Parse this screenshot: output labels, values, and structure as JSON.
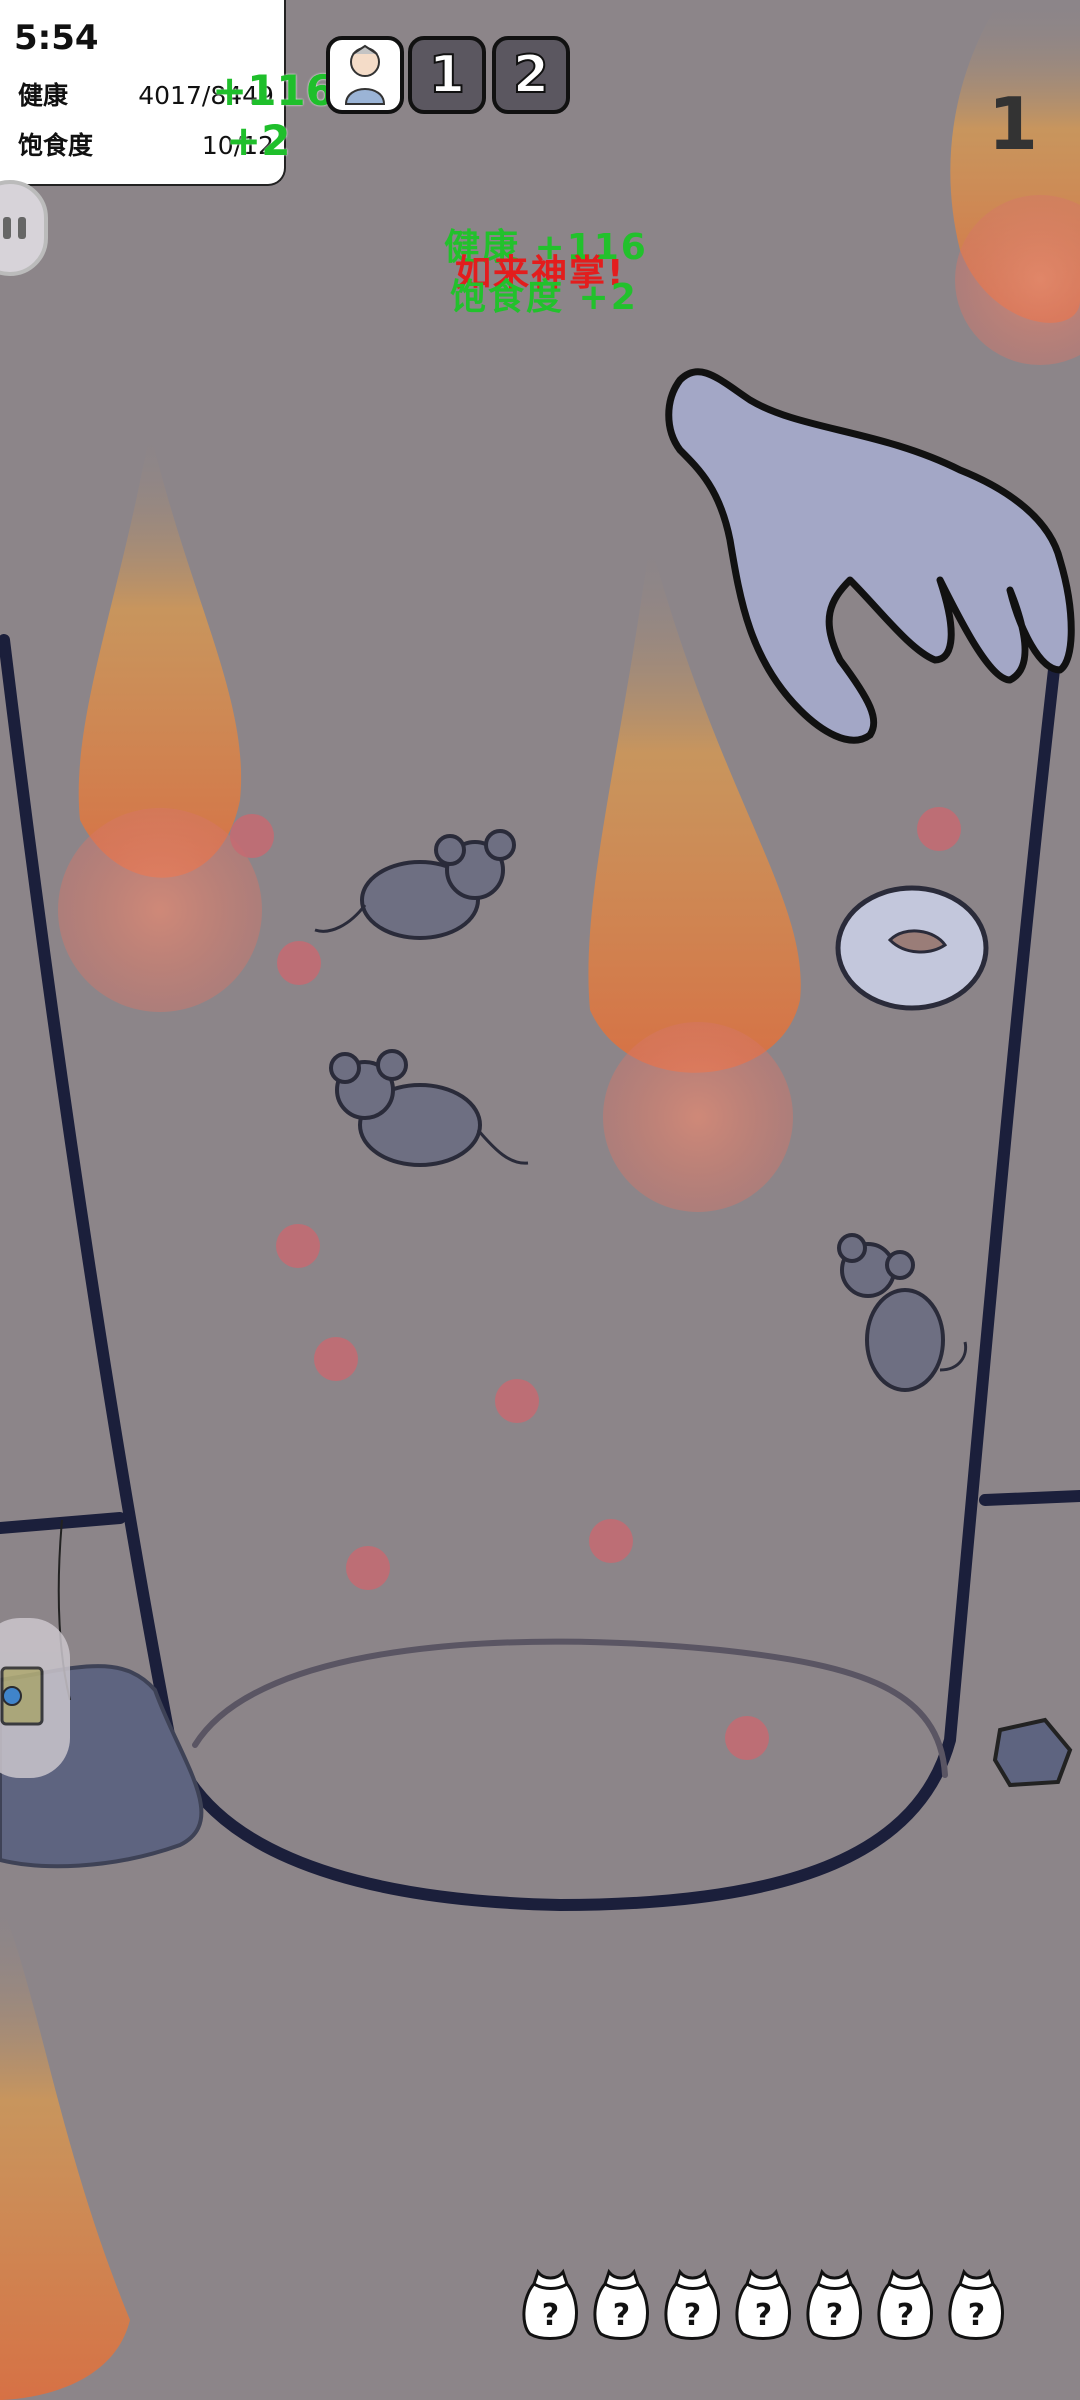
{
  "hud": {
    "time": "5:54",
    "health_label": "健康",
    "health_value": "4017/8449",
    "satiety_label": "饱食度",
    "satiety_value": "10/12",
    "health_gain": "+116",
    "satiety_gain": "+2"
  },
  "tags": {
    "slot_1": "1",
    "slot_2": "2"
  },
  "round_number": "1",
  "popup": {
    "health": "健康 +116",
    "skill": "如来神掌!",
    "satiety": "饱食度 +2"
  },
  "items": {
    "mystery_bag_label": "?",
    "mystery_bag_count": 7
  },
  "colors": {
    "background": "#8c8589",
    "cup_outline": "#1b1f3b",
    "hand_fill": "#a3a7c6",
    "rat_fill": "#6e6f82",
    "flame": "#f39a3a",
    "dot": "#c66a72",
    "gain_text": "#22c12c",
    "skill_text": "#e31d1d"
  }
}
